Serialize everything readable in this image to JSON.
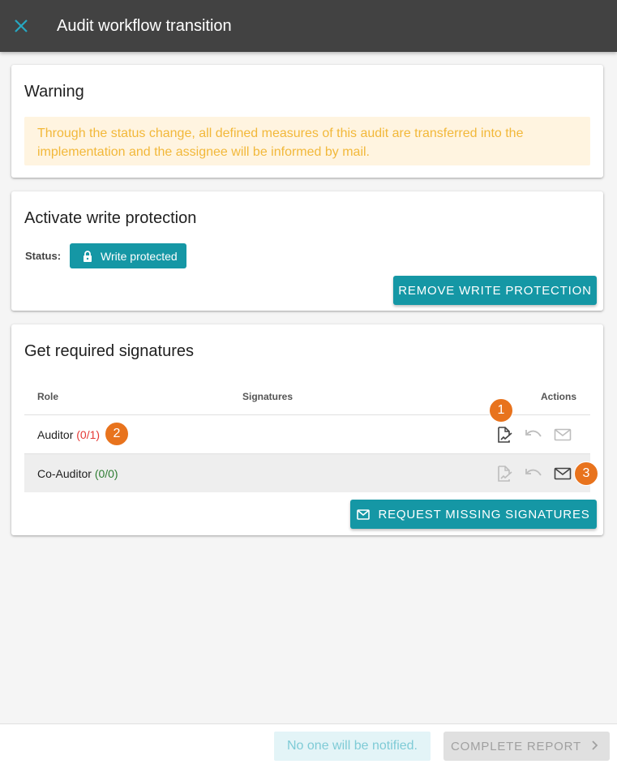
{
  "header": {
    "title": "Audit workflow transition",
    "close_icon": "close-icon"
  },
  "warning_card": {
    "title": "Warning",
    "message": "Through the status change, all defined measures of this audit are transferred into the implementation and the assignee will be informed by mail."
  },
  "write_protection_card": {
    "title": "Activate write protection",
    "status_label": "Status:",
    "status_badge": "Write protected",
    "status_icon": "lock-icon",
    "remove_button": "REMOVE WRITE PROTECTION"
  },
  "signatures_card": {
    "title": "Get required signatures",
    "columns": {
      "role": "Role",
      "signatures": "Signatures",
      "actions": "Actions"
    },
    "rows": [
      {
        "role": "Auditor",
        "count": "(0/1)",
        "count_color": "#e53935"
      },
      {
        "role": "Co-Auditor",
        "count": "(0/0)",
        "count_color": "#2e7d32"
      }
    ],
    "action_icons": [
      "sign-icon",
      "undo-icon",
      "mail-icon"
    ],
    "request_button": "REQUEST MISSING SIGNATURES",
    "request_icon": "mail-icon"
  },
  "annotations": [
    "1",
    "2",
    "3"
  ],
  "footer": {
    "notify_text": "No one will be notified.",
    "complete_button": "COMPLETE REPORT",
    "complete_icon": "chevron-right-icon"
  },
  "colors": {
    "accent": "#1597a5",
    "header": "#424242",
    "warning_bg": "#fff4e0",
    "warning_text": "#f2b83a",
    "annotation": "#e8731d"
  }
}
